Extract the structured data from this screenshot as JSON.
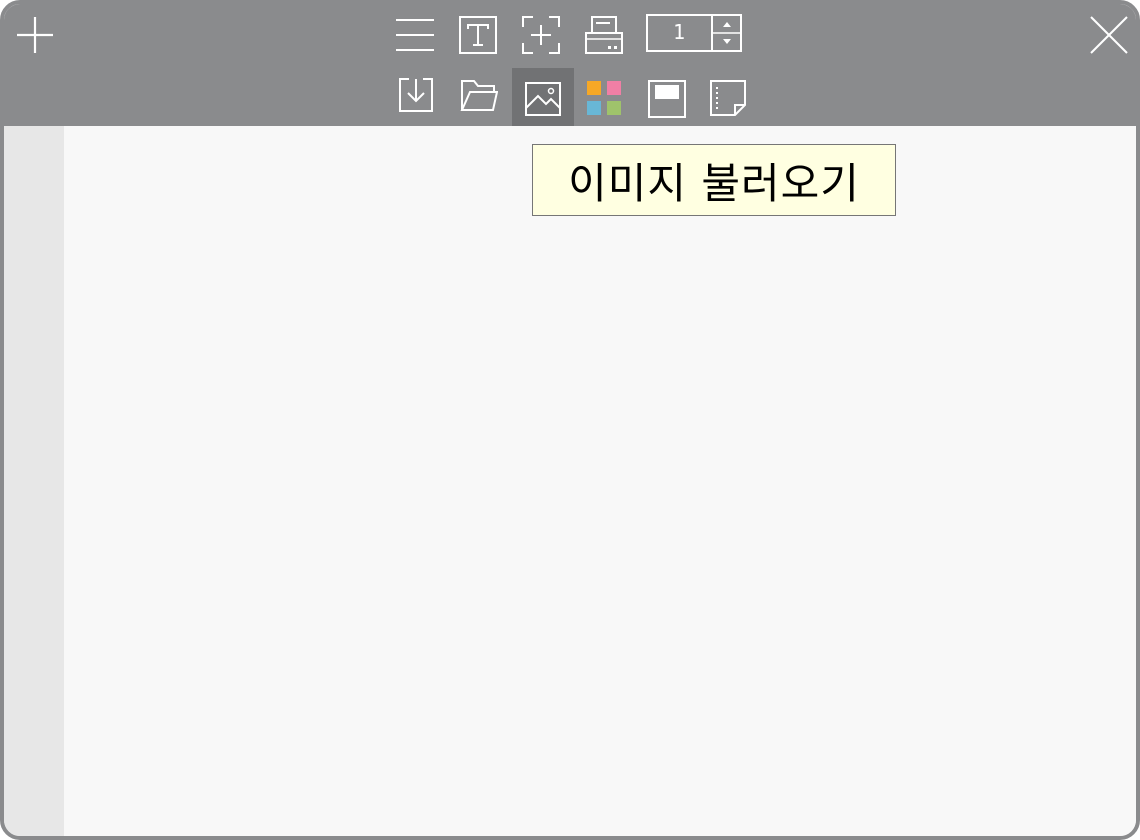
{
  "toolbar": {
    "background": "#8a8b8d",
    "page_number": "1",
    "row1": [
      {
        "icon": "menu-icon"
      },
      {
        "icon": "text-box-icon"
      },
      {
        "icon": "add-frame-icon"
      },
      {
        "icon": "printer-icon"
      }
    ],
    "row2": [
      {
        "icon": "download-icon"
      },
      {
        "icon": "folder-open-icon"
      },
      {
        "icon": "image-icon",
        "active": true
      },
      {
        "icon": "color-palette-icon",
        "colors": [
          "#f6a826",
          "#f07fa5",
          "#68b7d6",
          "#9fc36b"
        ]
      },
      {
        "icon": "window-header-icon"
      },
      {
        "icon": "note-page-icon"
      }
    ],
    "add_icon": "plus-icon",
    "close_icon": "close-icon"
  },
  "tooltip": {
    "text": "이미지 불러오기",
    "background": "#ffffe1"
  }
}
